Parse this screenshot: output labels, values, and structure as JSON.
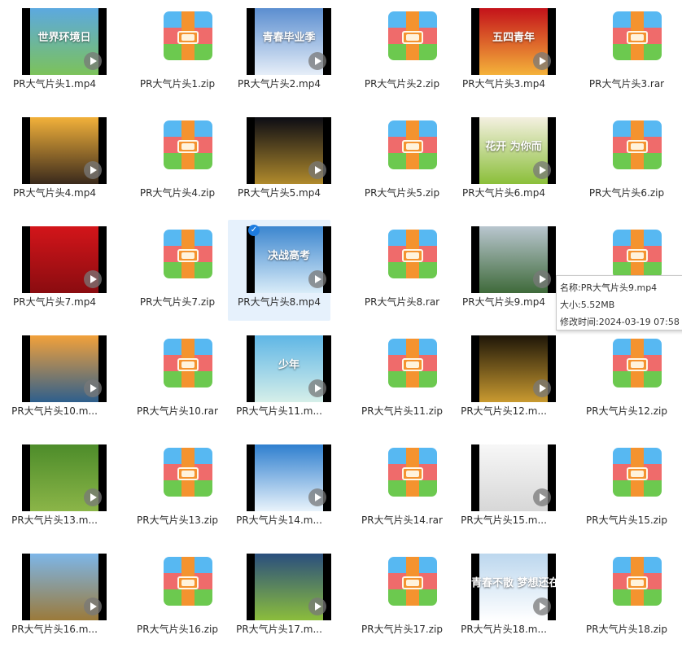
{
  "files": [
    {
      "name": "PR大气片头1.mp4",
      "type": "video",
      "thumb_text": "世界环境日",
      "colors": [
        "#5ca9e0",
        "#7cc25a"
      ]
    },
    {
      "name": "PR大气片头1.zip",
      "type": "archive"
    },
    {
      "name": "PR大气片头2.mp4",
      "type": "video",
      "thumb_text": "青春毕业季",
      "colors": [
        "#5b8ed0",
        "#e6eef8"
      ]
    },
    {
      "name": "PR大气片头2.zip",
      "type": "archive"
    },
    {
      "name": "PR大气片头3.mp4",
      "type": "video",
      "thumb_text": "五四青年",
      "colors": [
        "#c4121a",
        "#f4b23a"
      ]
    },
    {
      "name": "PR大气片头3.rar",
      "type": "archive"
    },
    {
      "name": "PR大气片头4.mp4",
      "type": "video",
      "thumb_text": "",
      "colors": [
        "#f2b13a",
        "#3a2a1c"
      ]
    },
    {
      "name": "PR大气片头4.zip",
      "type": "archive"
    },
    {
      "name": "PR大气片头5.mp4",
      "type": "video",
      "thumb_text": "",
      "colors": [
        "#0c0c14",
        "#b08a2c"
      ]
    },
    {
      "name": "PR大气片头5.zip",
      "type": "archive"
    },
    {
      "name": "PR大气片头6.mp4",
      "type": "video",
      "thumb_text": "花开 为你而",
      "colors": [
        "#f4f0e0",
        "#8bbf3a"
      ]
    },
    {
      "name": "PR大气片头6.zip",
      "type": "archive"
    },
    {
      "name": "PR大气片头7.mp4",
      "type": "video",
      "thumb_text": "",
      "colors": [
        "#d3151a",
        "#8a0c10"
      ]
    },
    {
      "name": "PR大气片头7.zip",
      "type": "archive"
    },
    {
      "name": "PR大气片头8.mp4",
      "type": "video",
      "thumb_text": "决战高考",
      "colors": [
        "#3c86cf",
        "#d9ecf8"
      ],
      "selected": true
    },
    {
      "name": "PR大气片头8.rar",
      "type": "archive"
    },
    {
      "name": "PR大气片头9.mp4",
      "type": "video",
      "thumb_text": "",
      "colors": [
        "#b9c6cf",
        "#3f6a3a"
      ]
    },
    {
      "name": "PR大气片头9.zip",
      "type": "archive"
    },
    {
      "name": "PR大气片头10.m...",
      "type": "video",
      "thumb_text": "",
      "colors": [
        "#f2a13a",
        "#2e5f8c"
      ]
    },
    {
      "name": "PR大气片头10.rar",
      "type": "archive"
    },
    {
      "name": "PR大气片头11.m...",
      "type": "video",
      "thumb_text": "少年",
      "colors": [
        "#5fb6e6",
        "#d6efe9"
      ]
    },
    {
      "name": "PR大气片头11.zip",
      "type": "archive"
    },
    {
      "name": "PR大气片头12.m...",
      "type": "video",
      "thumb_text": "",
      "colors": [
        "#1e1608",
        "#c99a30"
      ]
    },
    {
      "name": "PR大气片头12.zip",
      "type": "archive"
    },
    {
      "name": "PR大气片头13.m...",
      "type": "video",
      "thumb_text": "",
      "colors": [
        "#4d8c2a",
        "#8bb548"
      ]
    },
    {
      "name": "PR大气片头13.zip",
      "type": "archive"
    },
    {
      "name": "PR大气片头14.m...",
      "type": "video",
      "thumb_text": "",
      "colors": [
        "#2f7fcf",
        "#e9f3fb"
      ]
    },
    {
      "name": "PR大气片头14.rar",
      "type": "archive"
    },
    {
      "name": "PR大气片头15.m...",
      "type": "video",
      "thumb_text": "",
      "colors": [
        "#f7f7f7",
        "#d7d7d7"
      ]
    },
    {
      "name": "PR大气片头15.zip",
      "type": "archive"
    },
    {
      "name": "PR大气片头16.m...",
      "type": "video",
      "thumb_text": "",
      "colors": [
        "#7db6e8",
        "#9b7a3a"
      ]
    },
    {
      "name": "PR大气片头16.zip",
      "type": "archive"
    },
    {
      "name": "PR大气片头17.m...",
      "type": "video",
      "thumb_text": "",
      "colors": [
        "#2a4e7e",
        "#8bbd3c"
      ]
    },
    {
      "name": "PR大气片头17.zip",
      "type": "archive"
    },
    {
      "name": "PR大气片头18.m...",
      "type": "video",
      "thumb_text": "青春不散 梦想还在",
      "colors": [
        "#bcd7ee",
        "#ffffff"
      ]
    },
    {
      "name": "PR大气片头18.zip",
      "type": "archive"
    }
  ],
  "tooltip": {
    "name": "名称:PR大气片头9.mp4",
    "size": "大小:5.52MB",
    "modified": "修改时间:2024-03-19 07:58"
  }
}
